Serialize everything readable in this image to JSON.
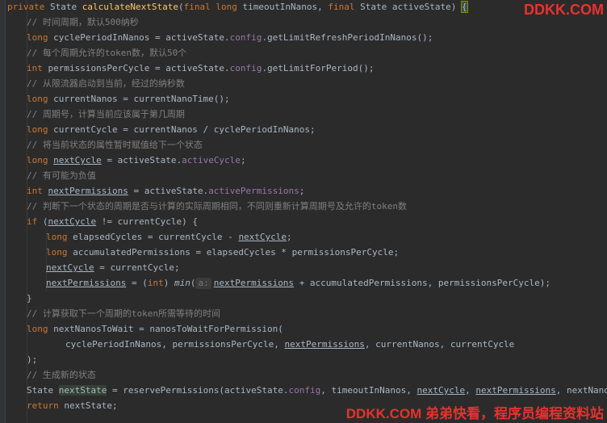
{
  "watermarks": {
    "top": "DDKK.COM",
    "bottom": "DDKK.COM 弟弟快看，程序员编程资料站"
  },
  "code": {
    "l1": {
      "t1": "private",
      "t2": "State",
      "t3": "calculateNextState",
      "t4": "(",
      "t5": "final",
      "t6": "long",
      "t7": "timeoutInNanos,",
      "t8": "final",
      "t9": "State activeState)",
      "t10": "{"
    },
    "l2": "// 时间周期，默认500纳秒",
    "l3": {
      "t1": "long",
      "t2": "cyclePeriodInNanos = activeState.",
      "t3": "config",
      "t4": ".getLimitRefreshPeriodInNanos();"
    },
    "l4": "// 每个周期允许的token数，默认50个",
    "l5": {
      "t1": "int",
      "t2": "permissionsPerCycle = activeState.",
      "t3": "config",
      "t4": ".getLimitForPeriod();"
    },
    "l6": "// 从限流器启动到当前，经过的纳秒数",
    "l7": {
      "t1": "long",
      "t2": "currentNanos = currentNanoTime();"
    },
    "l8": "// 周期号，计算当前应该属于第几周期",
    "l9": {
      "t1": "long",
      "t2": "currentCycle = currentNanos / cyclePeriodInNanos;"
    },
    "l10": "// 将当前状态的属性暂时赋值给下一个状态",
    "l11": {
      "t1": "long",
      "t2": "nextCycle",
      "t3": "= activeState.",
      "t4": "activeCycle",
      "t5": ";"
    },
    "l12": "// 有可能为负值",
    "l13": {
      "t1": "int",
      "t2": "nextPermissions",
      "t3": "= activeState.",
      "t4": "activePermissions",
      "t5": ";"
    },
    "l14": "// 判断下一个状态的周期是否与计算的实际周期相同，不同则重新计算周期号及允许的token数",
    "l15": {
      "t1": "if",
      "t2": "(",
      "t3": "nextCycle",
      "t4": "!= currentCycle) {"
    },
    "l16": {
      "t1": "long",
      "t2": "elapsedCycles = currentCycle -",
      "t3": "nextCycle",
      "t4": ";"
    },
    "l17": {
      "t1": "long",
      "t2": "accumulatedPermissions = elapsedCycles * permissionsPerCycle;"
    },
    "l18": {
      "t1": "nextCycle",
      "t2": "= currentCycle;"
    },
    "l19": {
      "t1": "nextPermissions",
      "t2": "= (",
      "t3": "int",
      "t4": ")",
      "t5": "min",
      "t6": "(",
      "t7": "a:",
      "t8": "nextPermissions",
      "t9": "+ accumulatedPermissions, permissionsPerCycle);"
    },
    "l20": "}",
    "l21": "// 计算获取下一个周期的token所需等待的时间",
    "l22": {
      "t1": "long",
      "t2": "nextNanosToWait = nanosToWaitForPermission("
    },
    "l23": {
      "t1": "cyclePeriodInNanos, permissionsPerCycle,",
      "t2": "nextPermissions",
      "t3": ", currentNanos, currentCycle"
    },
    "l24": ");",
    "l25": "// 生成新的状态",
    "l26": {
      "t1": "State",
      "t2": "nextState",
      "t3": "= reservePermissions(activeState.",
      "t4": "config",
      "t5": ", timeoutInNanos,",
      "t6": "nextCycle",
      "t7": ",",
      "t8": "nextPermissions",
      "t9": ", nextNanosToWait);"
    },
    "l27": {
      "t1": "return",
      "t2": "nextState;"
    }
  }
}
